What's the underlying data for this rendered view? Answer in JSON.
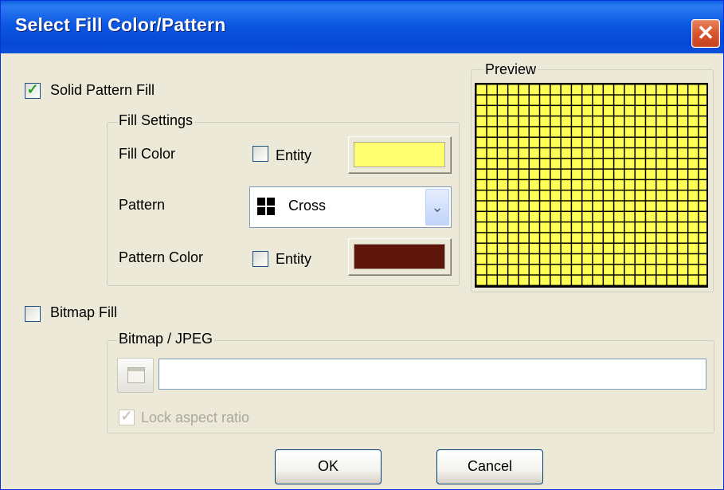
{
  "window": {
    "title": "Select Fill Color/Pattern",
    "close_glyph": "✕"
  },
  "solid_fill": {
    "label": "Solid Pattern Fill",
    "checked": true
  },
  "fill_settings": {
    "legend": "Fill Settings",
    "fill_color": {
      "label": "Fill Color",
      "entity_label": "Entity",
      "entity_checked": false,
      "color": "#ffff70"
    },
    "pattern": {
      "label": "Pattern",
      "selected": "Cross",
      "icon": "cross-pattern-icon"
    },
    "pattern_color": {
      "label": "Pattern Color",
      "entity_label": "Entity",
      "entity_checked": false,
      "color": "#5e160a"
    }
  },
  "preview": {
    "legend": "Preview",
    "fill_color": "#ffff55",
    "pattern_color": "#000000"
  },
  "bitmap_fill": {
    "label": "Bitmap Fill",
    "checked": false
  },
  "bitmap_group": {
    "legend": "Bitmap / JPEG",
    "path_value": "",
    "lock_aspect_label": "Lock aspect ratio",
    "lock_aspect_checked": true,
    "lock_aspect_enabled": false
  },
  "buttons": {
    "ok": "OK",
    "cancel": "Cancel"
  }
}
